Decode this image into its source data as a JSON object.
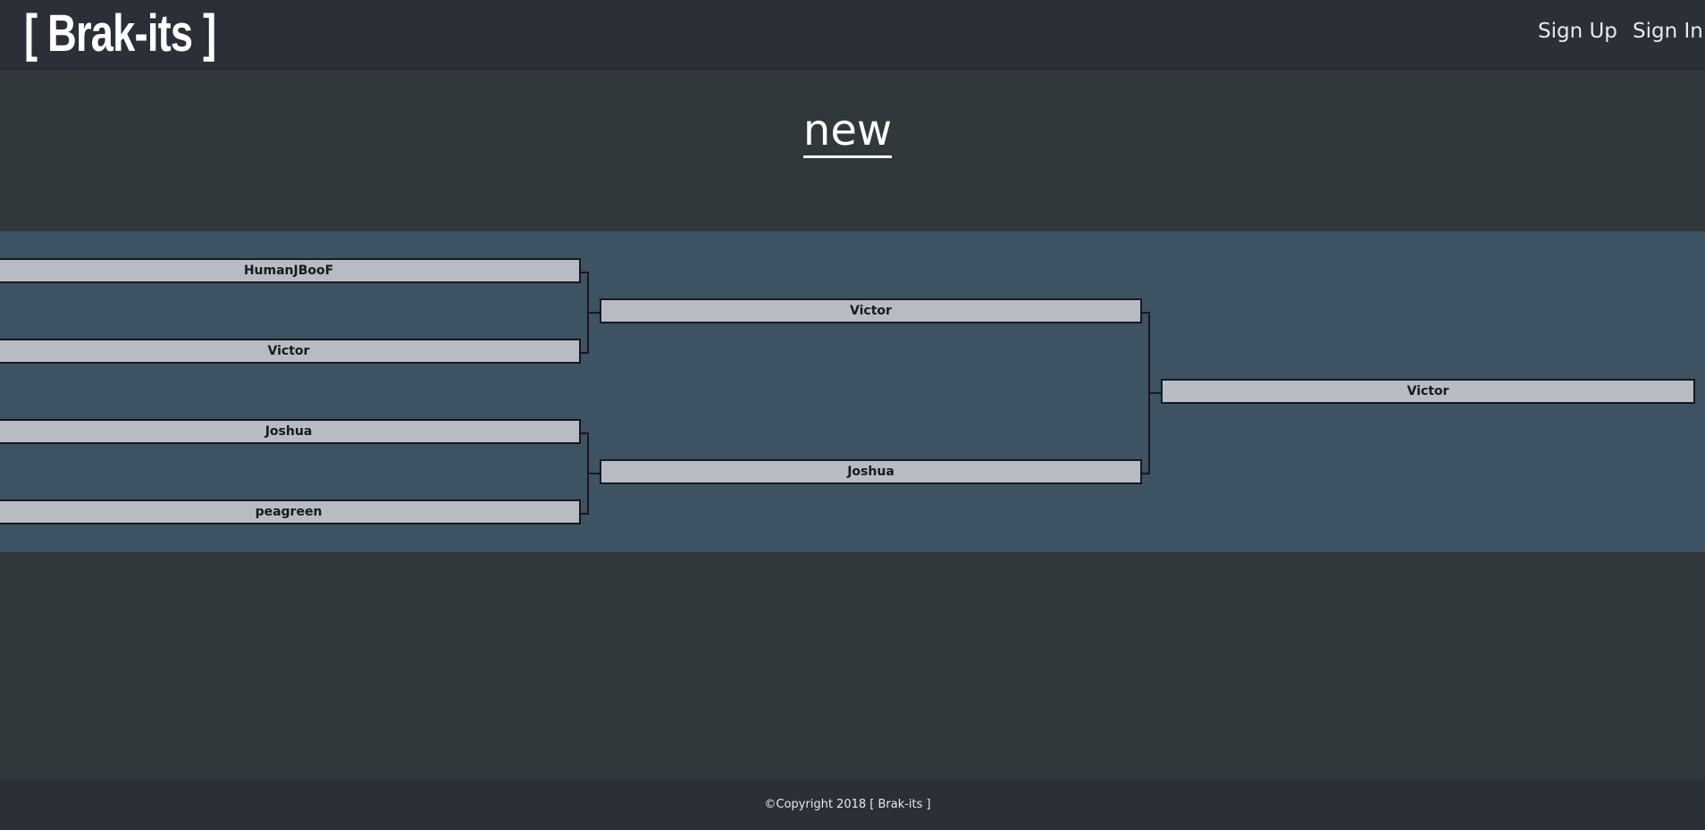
{
  "header": {
    "logo_text": "[ Brak-its ]",
    "nav": {
      "sign_up": "Sign Up",
      "sign_in": "Sign In"
    }
  },
  "page": {
    "title": "new"
  },
  "bracket": {
    "round1": [
      "HumanJBooF",
      "Victor",
      "Joshua",
      "peagreen"
    ],
    "round2": [
      "Victor",
      "Joshua"
    ],
    "final": "Victor"
  },
  "footer": {
    "copyright": "©Copyright 2018 [ Brak-its ]"
  },
  "colors": {
    "topbar": "#2a2f38",
    "body": "#31383c",
    "bracket_background": "#3d5263",
    "slot_fill": "#b6bcc2",
    "slot_border": "#17191c"
  }
}
